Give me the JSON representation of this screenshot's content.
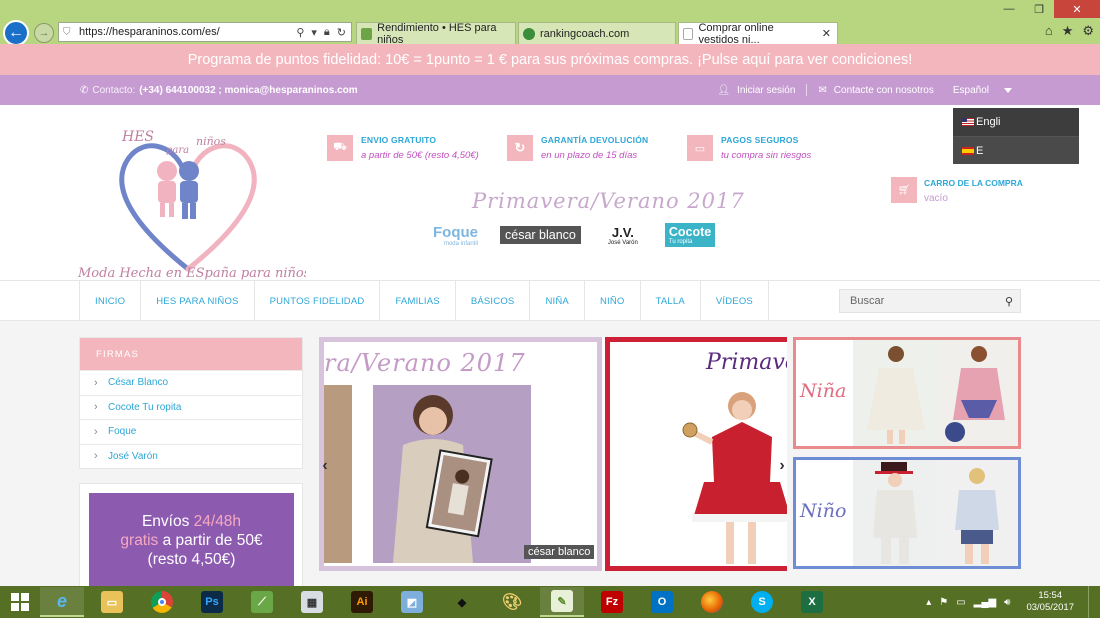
{
  "browser": {
    "url": "https://hesparaninos.com/es/",
    "tabs": [
      {
        "title": "Rendimiento • HES para niños",
        "active": false
      },
      {
        "title": "rankingcoach.com",
        "active": false
      },
      {
        "title": "Comprar online vestidos ni...",
        "active": true
      }
    ]
  },
  "promo": {
    "text": "Programa de puntos fidelidad: 10€ = 1punto = 1 € para sus próximas compras. ¡Pulse aquí para ver condiciones!"
  },
  "contact": {
    "label": "Contacto:",
    "phone_email": "(+34) 644100032 ; monica@hesparaninos.com",
    "login": "Iniciar sesión",
    "contact_us": "Contacte con nosotros",
    "language": "Español"
  },
  "language_menu": [
    {
      "label": "Engli"
    },
    {
      "label": "E"
    }
  ],
  "logo": {
    "hes": "HES",
    "para": "para",
    "ninos": "niños",
    "tagline": "Moda Hecha en ESpaña para niños"
  },
  "features": [
    {
      "title": "ENVIO GRATUITO",
      "subtitle": "a partir de 50€ (resto 4,50€)"
    },
    {
      "title": "GARANTÍA DEVOLUCIÓN",
      "subtitle": "en un plazo de 15 días"
    },
    {
      "title": "PAGOS SEGUROS",
      "subtitle": "tu compra sin riesgos"
    }
  ],
  "season": "Primavera/Verano 2017",
  "brands": {
    "foque": "Foque",
    "foque_sub": "moda infantil",
    "cesar": "césar blanco",
    "jv": "J.V.",
    "jv_sub": "José Varón",
    "cocote": "Cocote",
    "cocote_sub": "Tu ropita"
  },
  "cart": {
    "title": "CARRO DE LA COMPRA",
    "status": "vacío"
  },
  "menu": [
    "INICIO",
    "HES PARA NIÑOS",
    "PUNTOS FIDELIDAD",
    "FAMILIAS",
    "BÁSICOS",
    "NIÑA",
    "NIÑO",
    "TALLA",
    "VÍDEOS"
  ],
  "search": {
    "placeholder": "Buscar"
  },
  "firmas": {
    "title": "FIRMAS",
    "items": [
      "César Blanco",
      "Cocote Tu ropita",
      "Foque",
      "José Varón"
    ]
  },
  "envios": {
    "line1a": "Envíos ",
    "line1b": "24/48h",
    "line2a": "gratis",
    "line2b": " a partir de 50€",
    "line3": "(resto 4,50€)"
  },
  "slider": {
    "slide1_title": "ra/Verano 2017",
    "slide1_tag": "césar blanco",
    "slide2_title": "Primave"
  },
  "tiles": {
    "nina": "Niña",
    "nino": "Niño"
  },
  "taskbar": {
    "time": "15:54",
    "date": "03/05/2017"
  },
  "colors": {
    "pink": "#f4b6bd",
    "lilac": "#c59bd2",
    "blue_text": "#2ea7d7",
    "browser_green": "#b7d67f",
    "taskbar_green": "#556f25"
  }
}
